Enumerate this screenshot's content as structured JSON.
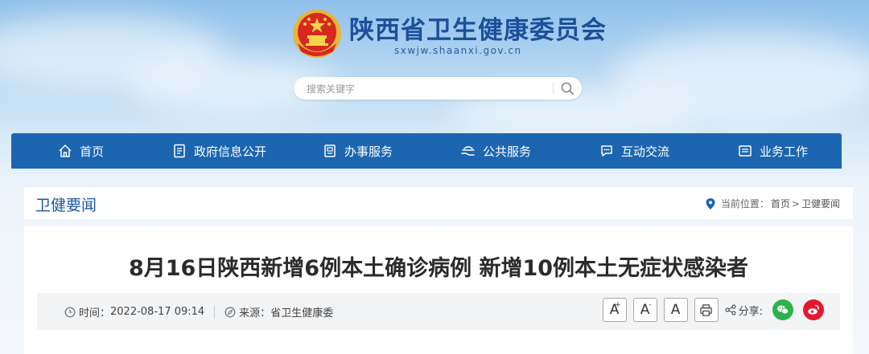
{
  "header": {
    "site_title": "陕西省卫生健康委员会",
    "site_domain": "sxwjw.shaanxi.gov.cn",
    "emblem": "national-emblem"
  },
  "search": {
    "placeholder": "搜索关键字",
    "icon": "search-icon"
  },
  "nav": {
    "items": [
      {
        "label": "首页",
        "icon": "home-icon"
      },
      {
        "label": "政府信息公开",
        "icon": "document-icon"
      },
      {
        "label": "办事服务",
        "icon": "clipboard-icon"
      },
      {
        "label": "公共服务",
        "icon": "hand-service-icon"
      },
      {
        "label": "互动交流",
        "icon": "chat-icon"
      },
      {
        "label": "业务工作",
        "icon": "folder-icon"
      }
    ]
  },
  "section": {
    "title": "卫健要闻",
    "breadcrumb": {
      "prefix": "当前位置：",
      "home": "首页",
      "separator": ">",
      "current": "卫健要闻"
    }
  },
  "article": {
    "title": "8月16日陕西新增6例本土确诊病例 新增10例本土无症状感染者",
    "time_label": "时间：",
    "time_value": "2022-08-17 09:14",
    "source_label": "来源：",
    "source_value": "省卫生健康委",
    "font_larger": "A",
    "font_smaller": "A",
    "font_normal": "A",
    "plus": "+",
    "minus": "-",
    "share_label": "分享:"
  },
  "colors": {
    "nav": "#1c65b0",
    "title": "#1d4f9a",
    "wechat": "#2bb24c",
    "weibo": "#e6162d"
  }
}
